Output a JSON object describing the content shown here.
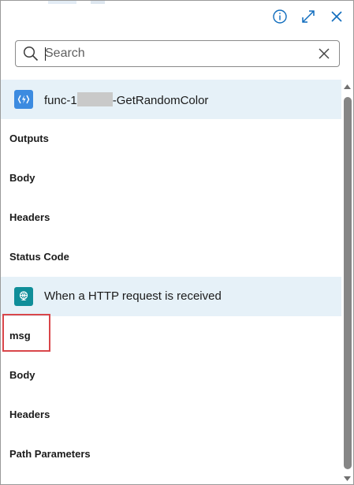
{
  "header": {
    "info_icon": "info-icon",
    "expand_icon": "expand-icon",
    "close_icon": "close-icon"
  },
  "search": {
    "placeholder": "Search",
    "value": ""
  },
  "groups": [
    {
      "icon": "azure-function-icon",
      "icon_color": "#3c8be0",
      "title_prefix": "func-1",
      "title_suffix": "-GetRandomColor",
      "items": [
        "Outputs",
        "Body",
        "Headers",
        "Status Code"
      ]
    },
    {
      "icon": "http-request-icon",
      "icon_color": "#108e99",
      "title": "When a HTTP request is received",
      "items": [
        "msg",
        "Body",
        "Headers",
        "Path Parameters"
      ]
    }
  ],
  "colors": {
    "group_header_bg": "#e6f1f8",
    "accent": "#0f6cbd",
    "highlight": "#d9464a"
  }
}
